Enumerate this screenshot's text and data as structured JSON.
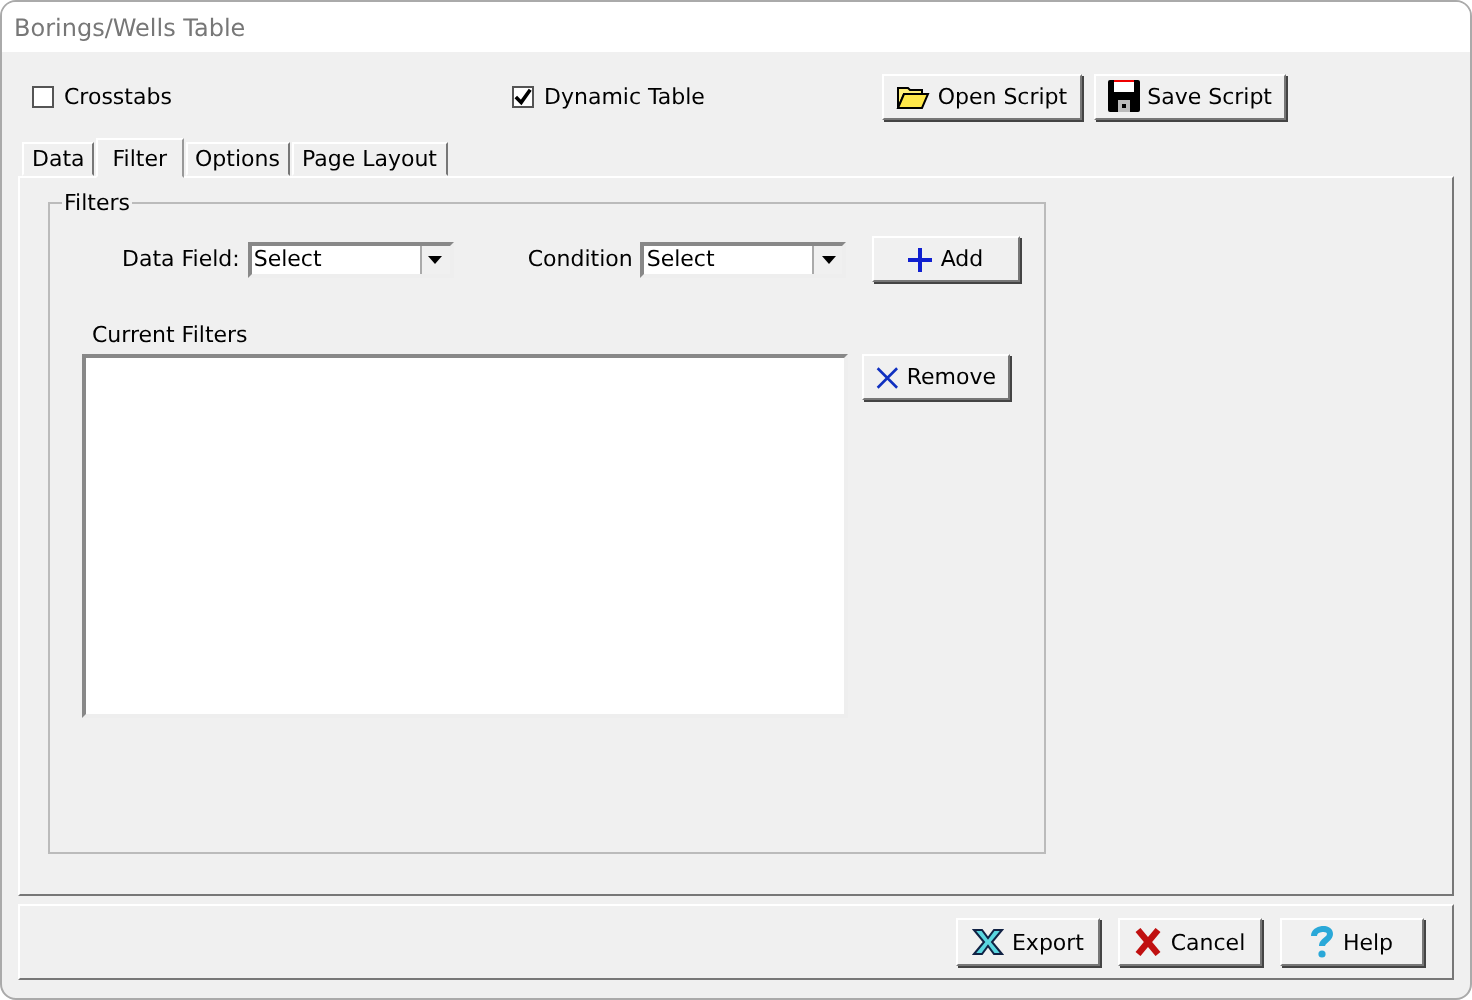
{
  "window": {
    "title": "Borings/Wells Table"
  },
  "options": [
    {
      "label": "Crosstabs",
      "checked": false
    },
    {
      "label": "Dynamic Table",
      "checked": true
    }
  ],
  "script_buttons": [
    {
      "label": "Open Script",
      "kind": "open"
    },
    {
      "label": "Save Script",
      "kind": "save"
    }
  ],
  "tabs": [
    {
      "label": "Data",
      "selected": false
    },
    {
      "label": "Filter",
      "selected": true
    },
    {
      "label": "Options",
      "selected": false
    },
    {
      "label": "Page Layout",
      "selected": false
    }
  ],
  "filters": {
    "title": "Filters",
    "data_field": {
      "label": "Data Field:",
      "value": "Select"
    },
    "condition": {
      "label": "Condition",
      "value": "Select"
    },
    "add_button": "Add",
    "current_label": "Current Filters",
    "remove_button": "Remove"
  },
  "footer_buttons": [
    {
      "label": "Export",
      "kind": "export"
    },
    {
      "label": "Cancel",
      "kind": "cancel"
    },
    {
      "label": "Help",
      "kind": "help"
    }
  ]
}
